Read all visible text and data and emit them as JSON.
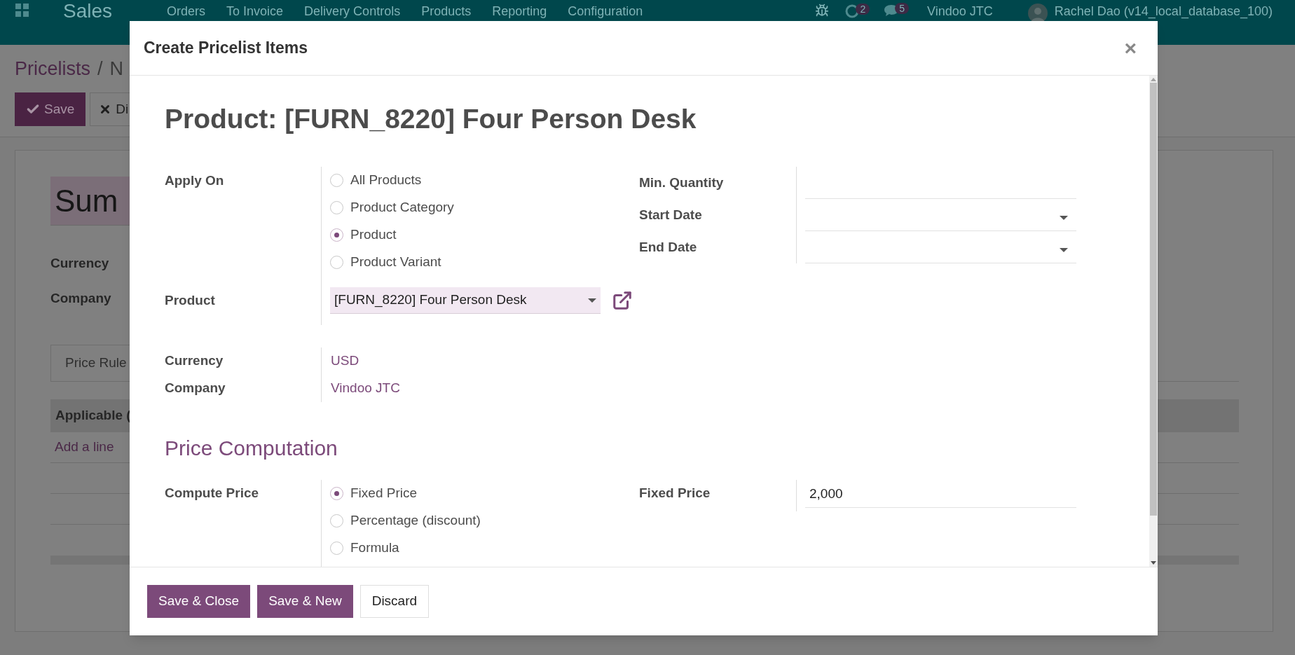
{
  "navbar": {
    "app_name": "Sales",
    "menu": [
      "Orders",
      "To Invoice",
      "Delivery Controls",
      "Products",
      "Reporting",
      "Configuration"
    ],
    "activity_count": "2",
    "message_count": "5",
    "company": "Vindoo JTC",
    "user": "Rachel Dao (v14_local_database_100)"
  },
  "page": {
    "breadcrumb": [
      {
        "label": "Pricelists"
      },
      {
        "label": "N"
      }
    ],
    "breadcrumb_separator": "/",
    "buttons": [
      {
        "label": "Save",
        "kind": "primary"
      },
      {
        "label": "Di",
        "kind": "secondary"
      }
    ],
    "name_field": "Sum",
    "fields": [
      "Currency",
      "Company"
    ],
    "tab": "Price Rule",
    "table_column": "Applicable (",
    "add_line": "Add a line"
  },
  "dialog": {
    "title": "Create Pricelist Items",
    "close": "×",
    "heading": "Product: [FURN_8220] Four Person Desk",
    "apply_on": {
      "label": "Apply On",
      "options": [
        {
          "label": "All Products",
          "selected": false
        },
        {
          "label": "Product Category",
          "selected": false
        },
        {
          "label": "Product",
          "selected": true
        },
        {
          "label": "Product Variant",
          "selected": false
        }
      ]
    },
    "product": {
      "label": "Product",
      "value": "[FURN_8220] Four Person Desk"
    },
    "right_fields": [
      {
        "label": "Min. Quantity",
        "kind": "text"
      },
      {
        "label": "Start Date",
        "kind": "date"
      },
      {
        "label": "End Date",
        "kind": "date"
      }
    ],
    "info": [
      {
        "label": "Currency",
        "value": "USD"
      },
      {
        "label": "Company",
        "value": "Vindoo JTC"
      }
    ],
    "section_title": "Price Computation",
    "compute_price": {
      "label": "Compute Price",
      "options": [
        {
          "label": "Fixed Price",
          "selected": true
        },
        {
          "label": "Percentage (discount)",
          "selected": false
        },
        {
          "label": "Formula",
          "selected": false
        }
      ]
    },
    "fixed_price": {
      "label": "Fixed Price",
      "value": "2,000"
    },
    "footer_buttons": [
      {
        "label": "Save & Close",
        "kind": "primary"
      },
      {
        "label": "Save & New",
        "kind": "primary"
      },
      {
        "label": "Discard",
        "kind": "secondary"
      }
    ]
  }
}
